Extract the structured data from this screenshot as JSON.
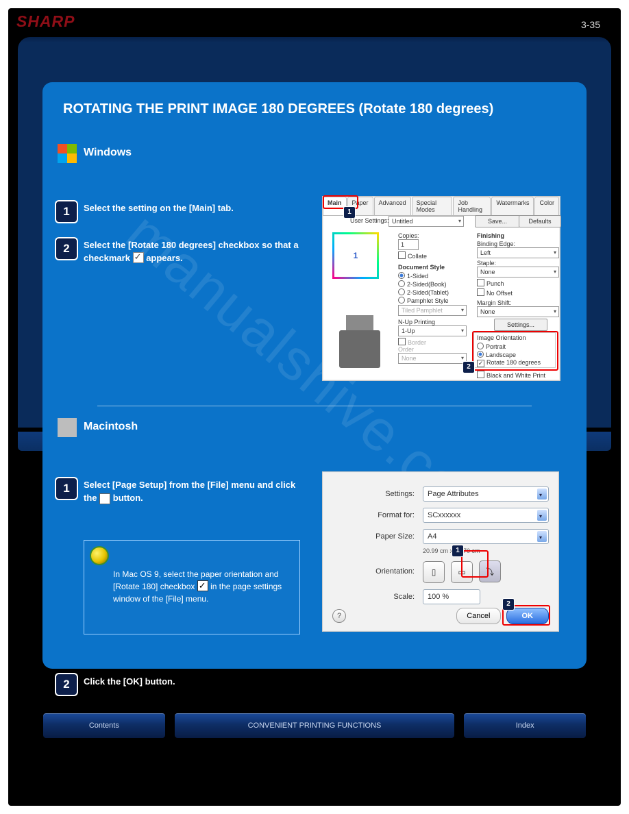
{
  "brand": "SHARP",
  "page_number": "3-35",
  "section_title": "ROTATING THE PRINT IMAGE 180 DEGREES (Rotate 180 degrees)",
  "windows": {
    "heading": "Windows",
    "step1": "Select the setting on the [Main] tab.",
    "step2_a": "Select the [Rotate 180 degrees] checkbox so that a checkmark ",
    "step2_b": " appears."
  },
  "mac": {
    "heading": "Macintosh",
    "step1_a": "Select [Page Setup] from the [File] menu and click the ",
    "step1_b": " button.",
    "note_a": "In Mac OS 9, select the paper orientation and [Rotate 180] checkbox ",
    "note_b": " in the page settings window of the [File] menu.",
    "step2": "Click the [OK] button."
  },
  "win_ss": {
    "tabs": [
      "Main",
      "Paper",
      "Advanced",
      "Special Modes",
      "Job Handling",
      "Watermarks",
      "Color"
    ],
    "user_settings_label": "User Settings:",
    "user_settings_value": "Untitled",
    "save": "Save...",
    "defaults": "Defaults",
    "copies_label": "Copies:",
    "copies_value": "1",
    "collate": "Collate",
    "doc_style": "Document Style",
    "ds_opts": [
      "1-Sided",
      "2-Sided(Book)",
      "2-Sided(Tablet)",
      "Pamphlet Style"
    ],
    "tiled_pamphlet": "Tiled Pamphlet",
    "nup_label": "N-Up Printing",
    "nup_value": "1-Up",
    "border": "Border",
    "order": "Order",
    "order_value": "None",
    "finishing": "Finishing",
    "binding_edge": "Binding Edge:",
    "binding_value": "Left",
    "staple": "Staple:",
    "staple_value": "None",
    "punch": "Punch",
    "no_offset": "No Offset",
    "margin_shift": "Margin Shift:",
    "margin_value": "None",
    "settings_btn": "Settings...",
    "image_orientation": "Image Orientation",
    "orient_opts": [
      "Portrait",
      "Landscape"
    ],
    "rotate": "Rotate 180 degrees",
    "bw": "Black and White Print",
    "preview_num": "1"
  },
  "mac_ss": {
    "settings_label": "Settings:",
    "settings_value": "Page Attributes",
    "format_label": "Format for:",
    "format_value": "SCxxxxxx",
    "paper_label": "Paper Size:",
    "paper_value": "A4",
    "paper_dims": "20.99 cm x 29.70 cm",
    "orient_label": "Orientation:",
    "scale_label": "Scale:",
    "scale_value": "100 %",
    "help": "?",
    "cancel": "Cancel",
    "ok": "OK"
  },
  "bottom": {
    "left": "Contents",
    "middle": "CONVENIENT PRINTING FUNCTIONS",
    "right": "Index"
  },
  "watermark": "manualshive.com"
}
